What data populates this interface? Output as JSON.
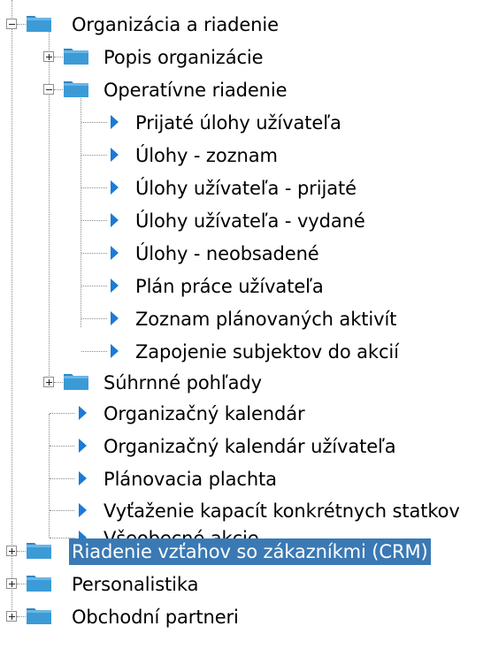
{
  "tree": {
    "nodes": [
      {
        "id": "organizacia",
        "label": "Organizácia a riadenie",
        "kind": "folder",
        "expander": "minus"
      },
      {
        "id": "popis",
        "label": "Popis organizácie",
        "kind": "folder",
        "expander": "plus"
      },
      {
        "id": "operativne",
        "label": "Operatívne riadenie",
        "kind": "folder",
        "expander": "minus"
      },
      {
        "id": "prijate-ulohy",
        "label": "Prijaté úlohy užívateľa",
        "kind": "item"
      },
      {
        "id": "ulohy-zoznam",
        "label": "Úlohy - zoznam",
        "kind": "item"
      },
      {
        "id": "ulohy-prijate",
        "label": "Úlohy užívateľa - prijaté",
        "kind": "item"
      },
      {
        "id": "ulohy-vydane",
        "label": "Úlohy užívateľa - vydané",
        "kind": "item"
      },
      {
        "id": "ulohy-neobsadene",
        "label": "Úlohy - neobsadené",
        "kind": "item"
      },
      {
        "id": "plan-prace",
        "label": "Plán práce užívateľa",
        "kind": "item"
      },
      {
        "id": "zoznam-aktivit",
        "label": "Zoznam plánovaných aktivít",
        "kind": "item"
      },
      {
        "id": "zapojenie",
        "label": "Zapojenie subjektov do akcií",
        "kind": "item"
      },
      {
        "id": "suhrnne",
        "label": "Súhrnné pohľady",
        "kind": "folder",
        "expander": "plus"
      },
      {
        "id": "org-kalendar",
        "label": "Organizačný kalendár",
        "kind": "item"
      },
      {
        "id": "org-kalendar-uz",
        "label": "Organizačný kalendár užívateľa",
        "kind": "item"
      },
      {
        "id": "planovacia",
        "label": "Plánovacia plachta",
        "kind": "item"
      },
      {
        "id": "vytazenie",
        "label": "Vyťaženie kapacít konkrétnych statkov",
        "kind": "item"
      },
      {
        "id": "vseobecne",
        "label": "Všeobecné akcie",
        "kind": "item"
      },
      {
        "id": "crm",
        "label": "Riadenie vzťahov so zákazníkmi (CRM)",
        "kind": "folder",
        "expander": "plus",
        "selected": true
      },
      {
        "id": "personalistika",
        "label": "Personalistika",
        "kind": "folder",
        "expander": "plus"
      },
      {
        "id": "obchodni",
        "label": "Obchodní partneri",
        "kind": "folder",
        "expander": "plus"
      }
    ]
  },
  "colors": {
    "selection_bg": "#3a79b4",
    "selection_text": "#ffffff",
    "folder_fill": "#3c9bd6",
    "arrow": "#1c7ad6",
    "tree_lines": "#8a8a8a"
  }
}
